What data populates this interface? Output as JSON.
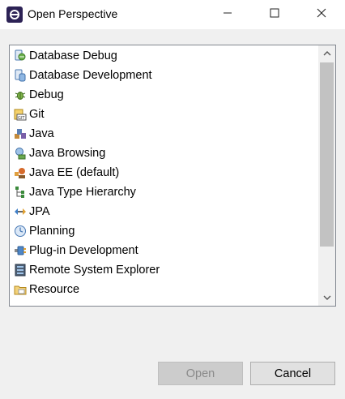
{
  "window": {
    "title": "Open Perspective",
    "icon": "eclipse-icon",
    "minimize_icon": "minimize-icon",
    "maximize_icon": "maximize-icon",
    "close_icon": "close-icon"
  },
  "perspectives": [
    {
      "label": "Database Debug",
      "icon": "database-debug-icon"
    },
    {
      "label": "Database Development",
      "icon": "database-development-icon"
    },
    {
      "label": "Debug",
      "icon": "debug-bug-icon"
    },
    {
      "label": "Git",
      "icon": "git-icon"
    },
    {
      "label": "Java",
      "icon": "java-icon"
    },
    {
      "label": "Java Browsing",
      "icon": "java-browsing-icon"
    },
    {
      "label": "Java EE (default)",
      "icon": "java-ee-icon"
    },
    {
      "label": "Java Type Hierarchy",
      "icon": "type-hierarchy-icon"
    },
    {
      "label": "JPA",
      "icon": "jpa-icon"
    },
    {
      "label": "Planning",
      "icon": "planning-icon"
    },
    {
      "label": "Plug-in Development",
      "icon": "plugin-development-icon"
    },
    {
      "label": "Remote System Explorer",
      "icon": "remote-system-explorer-icon"
    },
    {
      "label": "Resource",
      "icon": "resource-folder-icon"
    }
  ],
  "scrollbar": {
    "up_icon": "chevron-up-icon",
    "down_icon": "chevron-down-icon",
    "scroll_fraction": 0.0
  },
  "buttons": {
    "open_label": "Open",
    "cancel_label": "Cancel",
    "open_enabled": false
  }
}
